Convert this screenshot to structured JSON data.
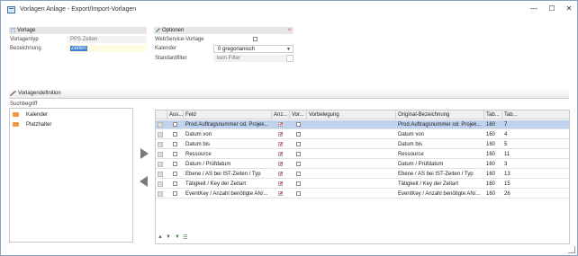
{
  "window": {
    "title": "Vorlagen Anlage - Export/Import-Vorlagen",
    "minimize": "—",
    "maximize": "☐",
    "close": "✕"
  },
  "vorlage": {
    "header": "Vorlage",
    "type_label": "Vorlagentyp",
    "type_value": "PPS Zeiten",
    "name_label": "Bezeichnung",
    "name_value": "Zeiten"
  },
  "optionen": {
    "header": "Optionen",
    "pin_icon": "pin-icon",
    "rows": [
      {
        "label": "WebService-Vorlage",
        "value": ""
      },
      {
        "label": "Kalender",
        "value": "0 gregorianisch"
      },
      {
        "label": "Standardfilter",
        "value": "kein Filter"
      }
    ]
  },
  "section": {
    "title": "Vorlagendefinition"
  },
  "left": {
    "search_label": "Suchbegriff",
    "items": [
      {
        "label": "Kalender"
      },
      {
        "label": "Platzhalter"
      }
    ]
  },
  "grid": {
    "columns": [
      "Aus...",
      "Feld",
      "Anz...",
      "Vor...",
      "Vorbelegung",
      "Original-Bezeichnung",
      "Tab...",
      "Tab..."
    ],
    "rows": [
      {
        "feld": "Prod.Auftragsnummer od. Projek...",
        "anz": true,
        "vorbelegung": "",
        "orig": "Prod.Auftragsnummer od. Projek...",
        "tab1": "160",
        "tab2": "7",
        "selected": true
      },
      {
        "feld": "Datum von",
        "anz": true,
        "vorbelegung": "",
        "orig": "Datum von",
        "tab1": "160",
        "tab2": "4",
        "selected": false
      },
      {
        "feld": "Datum bis",
        "anz": true,
        "vorbelegung": "",
        "orig": "Datum bis",
        "tab1": "160",
        "tab2": "5",
        "selected": false
      },
      {
        "feld": "Ressource",
        "anz": true,
        "vorbelegung": "",
        "orig": "Ressource",
        "tab1": "160",
        "tab2": "11",
        "selected": false
      },
      {
        "feld": "Datum / Prüfdatum",
        "anz": true,
        "vorbelegung": "",
        "orig": "Datum / Prüfdatum",
        "tab1": "160",
        "tab2": "3",
        "selected": false
      },
      {
        "feld": "Ebene / AS bei IST-Zeiten / Typ",
        "anz": true,
        "vorbelegung": "",
        "orig": "Ebene / AS bei IST-Zeiten / Typ",
        "tab1": "160",
        "tab2": "13",
        "selected": false
      },
      {
        "feld": "Tätigkeit / Key der Zeitart",
        "anz": true,
        "vorbelegung": "",
        "orig": "Tätigkeit / Key der Zeitart",
        "tab1": "160",
        "tab2": "15",
        "selected": false
      },
      {
        "feld": "EventKey / Anzahl benötigte AN/...",
        "anz": true,
        "vorbelegung": "",
        "orig": "EventKey / Anzahl benötigte AN/...",
        "tab1": "160",
        "tab2": "26",
        "selected": false
      }
    ]
  },
  "bottom_icons": [
    "move-up-icon",
    "move-down-icon",
    "filter-icon",
    "list-icon"
  ],
  "colors": {
    "accent": "#3d7fd6",
    "check": "#d6263a",
    "selected_row": "#bfd3ee",
    "tab_icon": "#f09a3a"
  }
}
